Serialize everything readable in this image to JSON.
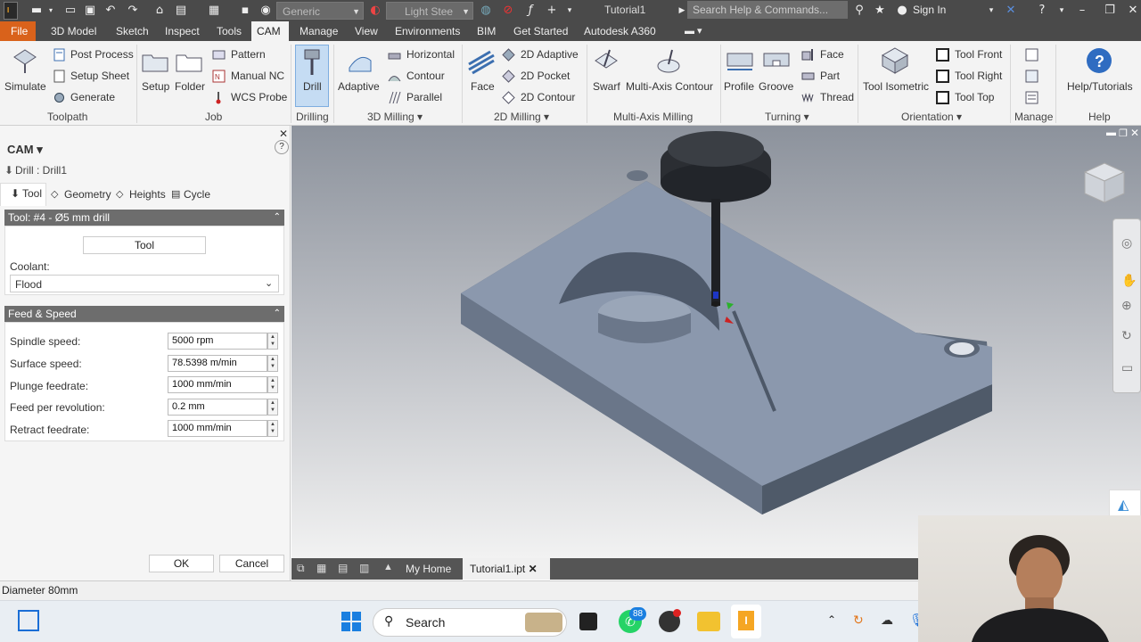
{
  "quick_access": {
    "material": "Generic",
    "appearance": "Light Stee",
    "document_title": "Tutorial1",
    "search_placeholder": "Search Help & Commands...",
    "signin": "Sign In"
  },
  "menu_tabs": [
    "File",
    "3D Model",
    "Sketch",
    "Inspect",
    "Tools",
    "CAM",
    "Manage",
    "View",
    "Environments",
    "BIM",
    "Get Started",
    "Autodesk A360"
  ],
  "active_tab": "CAM",
  "ribbon": {
    "toolpath": {
      "simulate": "Simulate",
      "post_process": "Post Process",
      "setup_sheet": "Setup Sheet",
      "generate": "Generate",
      "group": "Toolpath"
    },
    "job": {
      "setup": "Setup",
      "folder": "Folder",
      "pattern": "Pattern",
      "manual_nc": "Manual NC",
      "wcs_probe": "WCS Probe",
      "group": "Job"
    },
    "drilling": {
      "drill": "Drill",
      "group": "Drilling"
    },
    "milling3d": {
      "adaptive": "Adaptive",
      "horizontal": "Horizontal",
      "contour": "Contour",
      "parallel": "Parallel",
      "group": "3D Milling"
    },
    "milling2d": {
      "face": "Face",
      "adaptive2d": "2D Adaptive",
      "pocket2d": "2D Pocket",
      "contour2d": "2D Contour",
      "group": "2D Milling"
    },
    "multiaxis": {
      "swarf": "Swarf",
      "multi_axis_contour": "Multi-Axis Contour",
      "group": "Multi-Axis Milling"
    },
    "turning": {
      "profile": "Profile",
      "groove": "Groove",
      "face": "Face",
      "part": "Part",
      "thread": "Thread",
      "group": "Turning"
    },
    "orientation": {
      "tool_isometric": "Tool Isometric",
      "tool_front": "Tool Front",
      "tool_right": "Tool Right",
      "tool_top": "Tool Top",
      "group": "Orientation"
    },
    "manage": {
      "group": "Manage"
    },
    "help": {
      "help_tutorials": "Help/Tutorials",
      "group": "Help"
    }
  },
  "panel": {
    "title": "CAM",
    "operation": "Drill : Drill1",
    "tabs": [
      "Tool",
      "Geometry",
      "Heights",
      "Cycle"
    ],
    "tool_section": "Tool: #4 - Ø5 mm drill",
    "tool_button": "Tool",
    "coolant_label": "Coolant:",
    "coolant_value": "Flood",
    "feed_section": "Feed & Speed",
    "fields": [
      {
        "label": "Spindle speed:",
        "value": "5000 rpm"
      },
      {
        "label": "Surface speed:",
        "value": "78.5398 m/min"
      },
      {
        "label": "Plunge feedrate:",
        "value": "1000 mm/min"
      },
      {
        "label": "Feed per revolution:",
        "value": "0.2 mm"
      },
      {
        "label": "Retract feedrate:",
        "value": "1000 mm/min"
      }
    ],
    "ok": "OK",
    "cancel": "Cancel"
  },
  "doc_tabs": {
    "home": "My Home",
    "file": "Tutorial1.ipt"
  },
  "status": "Diameter 80mm",
  "taskbar": {
    "search": "Search",
    "whatsapp_badge": "88"
  },
  "colors": {
    "file_tab": "#d9621b",
    "part": "#8b98ad",
    "ribbon_bg": "#f3f3f3",
    "dark_chrome": "#4a4a4a"
  }
}
